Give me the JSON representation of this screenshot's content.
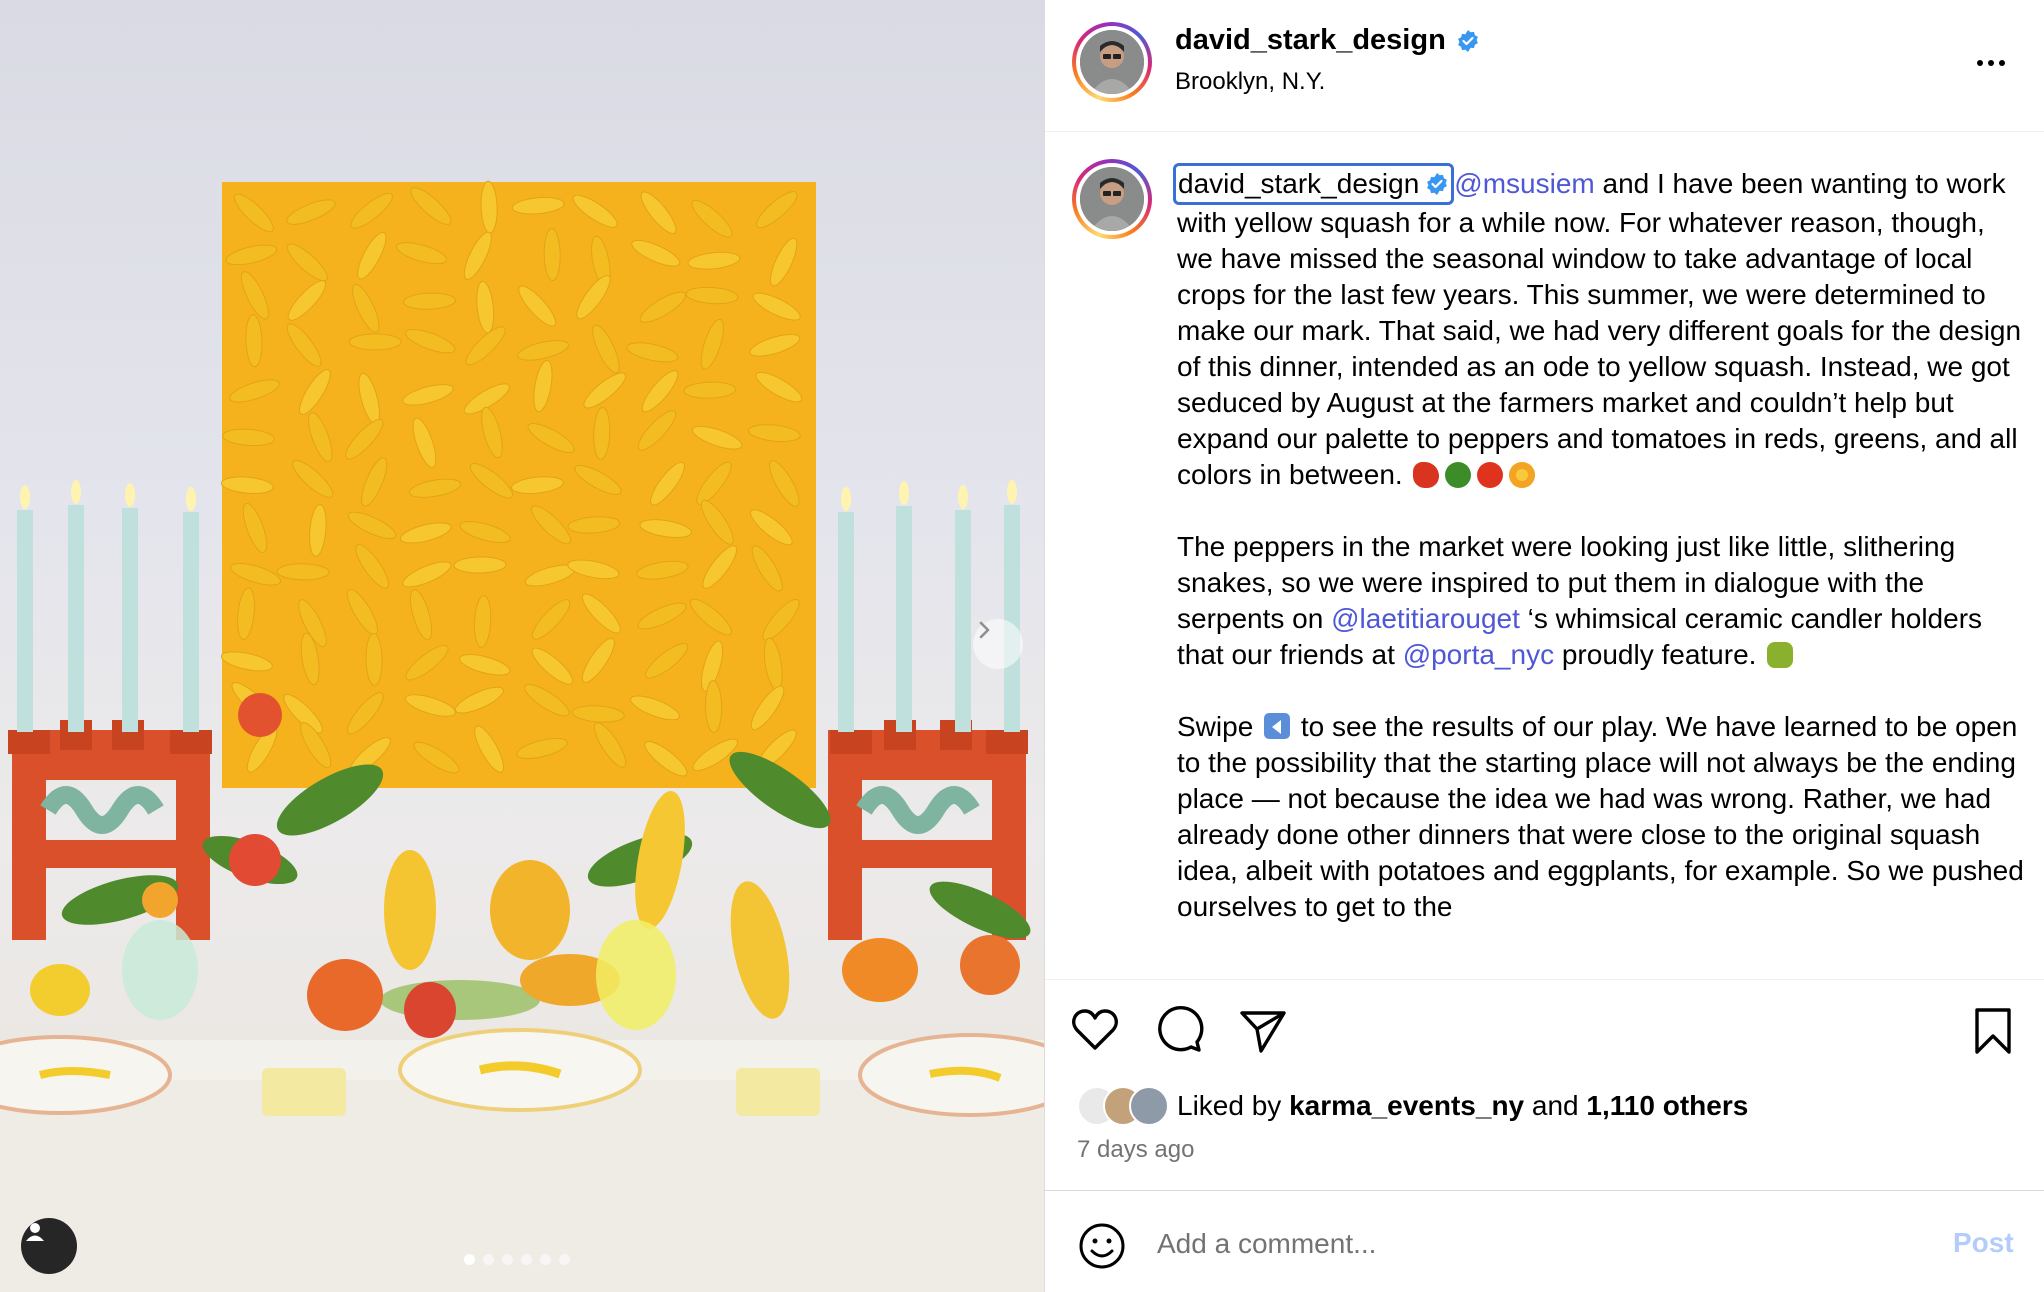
{
  "post": {
    "username": "david_stark_design",
    "location": "Brooklyn, N.Y.",
    "verified": true
  },
  "media": {
    "carousel_total": 6,
    "carousel_active": 1
  },
  "caption": {
    "username": "david_stark_design",
    "p1": {
      "mention": "@msusiem",
      "text": " and I have been wanting to work with yellow squash for a while now. For whatever reason, though, we have missed the seasonal window to take advantage of local crops for the last few years. This summer, we were determined to make our mark. That said, we had very different goals for the design of this dinner, intended as an ode to yellow squash. Instead, we got seduced by August at the farmers market and couldn’t help but expand our palette to peppers and tomatoes in reds, greens, and all colors in between.",
      "emojis": [
        "hot-pepper",
        "bell-pepper",
        "tomato",
        "sunflower"
      ]
    },
    "p2": {
      "t1": "The peppers in the market were looking just like little, slithering snakes, so we were inspired to put them in dialogue with the serpents on ",
      "mention1": "@laetitiarouget",
      "t2": " ‘s whimsical ceramic candler holders that our friends at ",
      "mention2": "@porta_nyc",
      "t3": " proudly feature.",
      "emoji": "snake"
    },
    "p3": {
      "t1": "Swipe",
      "emoji": "left-arrow-button",
      "t2": " to see the results of our play. We have learned to be open to the possibility that the starting place will not always be the ending place — not because the idea we had was wrong. Rather, we had already done other dinners that were close to the original squash idea, albeit with potatoes and eggplants, for example. So we pushed ourselves to get to the"
    }
  },
  "likes": {
    "prefix": "Liked by ",
    "user": "karma_events_ny",
    "and": " and ",
    "others": "1,110 others"
  },
  "timestamp": "7 days ago",
  "comment": {
    "placeholder": "Add a comment...",
    "post_label": "Post"
  },
  "colors": {
    "mention": "#4e57d6",
    "verified": "#3897f0",
    "post_disabled": "#b3cdfb",
    "muted": "#737373"
  }
}
